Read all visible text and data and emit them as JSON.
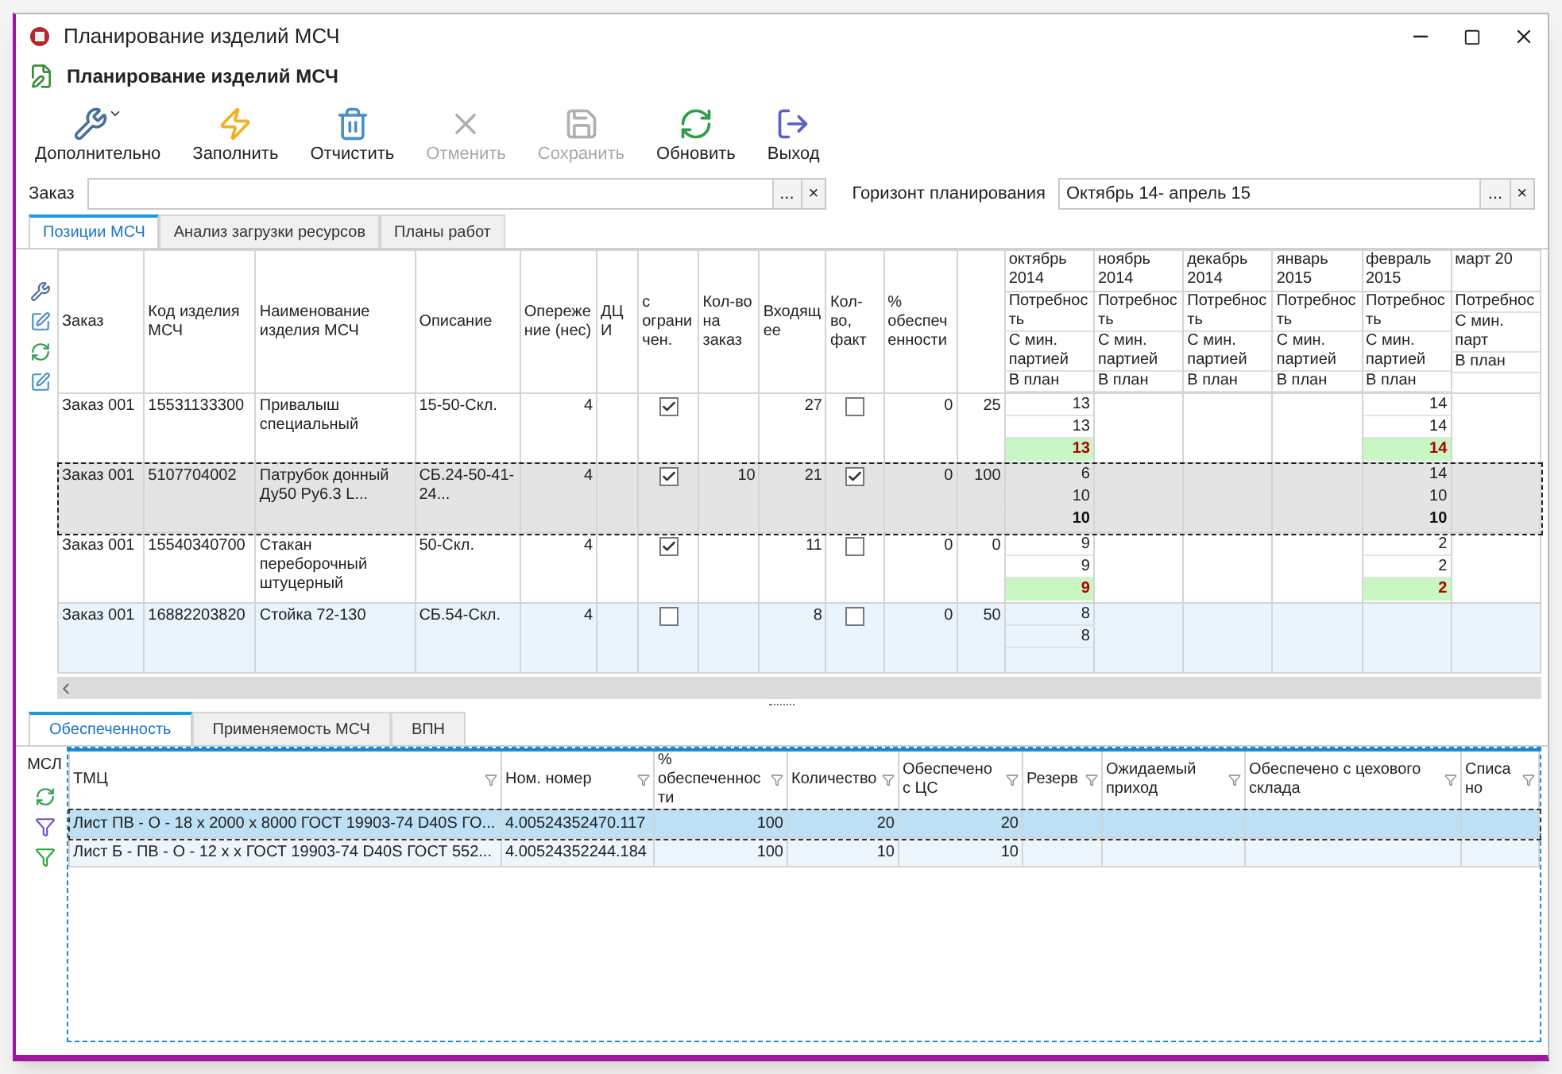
{
  "window": {
    "title": "Планирование изделий МСЧ"
  },
  "header": {
    "title": "Планирование изделий МСЧ"
  },
  "toolbar": [
    {
      "label": "Дополнительно",
      "dropdown": true,
      "disabled": false
    },
    {
      "label": "Заполнить",
      "dropdown": false,
      "disabled": false
    },
    {
      "label": "Отчистить",
      "dropdown": false,
      "disabled": false
    },
    {
      "label": "Отменить",
      "dropdown": false,
      "disabled": true
    },
    {
      "label": "Сохранить",
      "dropdown": false,
      "disabled": true
    },
    {
      "label": "Обновить",
      "dropdown": false,
      "disabled": false
    },
    {
      "label": "Выход",
      "dropdown": false,
      "disabled": false
    }
  ],
  "order_field": {
    "label": "Заказ",
    "buttons": [
      "...",
      "×"
    ]
  },
  "horizon_field": {
    "label": "Горизонт планирования",
    "value": "Октябрь 14- апрель 15",
    "buttons": [
      "...",
      "×"
    ]
  },
  "tabs": [
    {
      "label": "Позиции МСЧ",
      "selected": true
    },
    {
      "label": "Анализ загрузки ресурсов",
      "selected": false
    },
    {
      "label": "Планы работ",
      "selected": false
    }
  ],
  "grid": {
    "columns": [
      {
        "label": "Заказ",
        "kind": "text"
      },
      {
        "label": "Код изделия МСЧ",
        "kind": "text"
      },
      {
        "label": "Наименование изделия МСЧ",
        "kind": "text"
      },
      {
        "label": "Описание",
        "kind": "text"
      },
      {
        "label": "Опережение (нес)",
        "kind": "number"
      },
      {
        "label": "ДЦИ",
        "kind": "number"
      },
      {
        "label": "с ограничен.",
        "kind": "check"
      },
      {
        "label": "Кол-во на заказ",
        "kind": "number"
      },
      {
        "label": "Входящее",
        "kind": "number"
      },
      {
        "label": "Кол-во, факт",
        "kind": "check"
      },
      {
        "label": "% обеспеченности",
        "kind": "number"
      },
      {
        "kind": "number"
      }
    ],
    "months": [
      {
        "label": "октябрь 2014",
        "sublabels": [
          "Потребность",
          "С мин. партией",
          "В план"
        ]
      },
      {
        "label": "ноябрь 2014",
        "sublabels": [
          "Потребность",
          "С мин. партией",
          "В план"
        ]
      },
      {
        "label": "декабрь 2014",
        "sublabels": [
          "Потребность",
          "С мин. партией",
          "В план"
        ]
      },
      {
        "label": "январь 2015",
        "sublabels": [
          "Потребность",
          "С мин. партией",
          "В план"
        ]
      },
      {
        "label": "февраль 2015",
        "sublabels": [
          "Потребность",
          "С мин. партией",
          "В план"
        ]
      },
      {
        "label": "март 20",
        "sublabels": [
          "Потребнос",
          "С мин. парт",
          "В план"
        ]
      }
    ],
    "rows": [
      {
        "selected": false,
        "order": "Заказ 001",
        "code": "15531133300",
        "name": "Привалыш специальный",
        "description": "15-50-Скл.",
        "lead": "4",
        "limited": true,
        "incoming": "27",
        "fact": false,
        "percent": "0",
        "column_12": "25",
        "plan": [
          {
            "kind": "filled",
            "need": "13",
            "min_batch": "13",
            "plan": "13",
            "shortage": true
          },
          {
            "kind": "blank"
          },
          {
            "kind": "blank"
          },
          {
            "kind": "blank"
          },
          {
            "kind": "filled",
            "need": "14",
            "min_batch": "14",
            "plan": "14",
            "shortage": true
          },
          {
            "kind": "blank"
          }
        ]
      },
      {
        "selected": true,
        "order": "Заказ 001",
        "code": "5107704002",
        "name": "Патрубок донный Ду50 Ру6.3 L...",
        "description": "СБ.24-50-41-24...",
        "lead": "4",
        "limited": true,
        "order_qty": "10",
        "incoming": "21",
        "fact": true,
        "percent": "0",
        "column_12": "100",
        "plan": [
          {
            "kind": "filled",
            "need": "6",
            "min_batch": "10",
            "plan": "10",
            "shortage": false
          },
          {
            "kind": "blank"
          },
          {
            "kind": "blank"
          },
          {
            "kind": "blank"
          },
          {
            "kind": "filled",
            "need": "14",
            "min_batch": "10",
            "plan": "10",
            "shortage": false
          },
          {
            "kind": "blank"
          }
        ]
      },
      {
        "selected": false,
        "order": "Заказ 001",
        "code": "15540340700",
        "name": "Стакан переборочный штуцерный",
        "description": "50-Скл.",
        "lead": "4",
        "limited": true,
        "incoming": "11",
        "fact": false,
        "percent": "0",
        "column_12": "0",
        "plan": [
          {
            "kind": "filled",
            "need": "9",
            "min_batch": "9",
            "plan": "9",
            "shortage": true
          },
          {
            "kind": "blank"
          },
          {
            "kind": "blank"
          },
          {
            "kind": "blank"
          },
          {
            "kind": "filled",
            "need": "2",
            "min_batch": "2",
            "plan": "2",
            "shortage": true
          },
          {
            "kind": "blank"
          }
        ]
      },
      {
        "selected": false,
        "order": "Заказ 001",
        "code": "16882203820",
        "name": "Стойка 72-130",
        "description": "СБ.54-Скл.",
        "lead": "4",
        "limited": false,
        "incoming": "8",
        "fact": false,
        "percent": "0",
        "column_12": "50",
        "plan": [
          {
            "kind": "partial",
            "need": "8",
            "min_batch": "8"
          },
          {
            "kind": "blank"
          },
          {
            "kind": "blank"
          },
          {
            "kind": "blank"
          },
          {
            "kind": "blank"
          },
          {
            "kind": "blank"
          }
        ]
      }
    ]
  },
  "bottom_tabs": [
    {
      "label": "Обеспеченность",
      "selected": true
    },
    {
      "label": "Применяемость МСЧ",
      "selected": false
    },
    {
      "label": "ВПН",
      "selected": false
    }
  ],
  "side_label": "МСЛ",
  "supply": {
    "columns": [
      "ТМЦ",
      "Ном. номер",
      "% обеспеченности",
      "Количество",
      "Обеспечено с ЦС",
      "Резерв",
      "Ожидаемый приход",
      "Обеспечено с цехового склада",
      "Списано"
    ],
    "rows": [
      {
        "selected": true,
        "cells": [
          "Лист ПВ - О - 18 х 2000 х 8000 ГОСТ 19903-74 D40S ГО...",
          "4.00524352470.117",
          "100",
          "20",
          "20"
        ]
      },
      {
        "selected": false,
        "cells": [
          "Лист Б - ПВ - О - 12 х  х  ГОСТ 19903-74 D40S ГОСТ 552...",
          "4.00524352244.184",
          "100",
          "10",
          "10"
        ]
      }
    ]
  }
}
